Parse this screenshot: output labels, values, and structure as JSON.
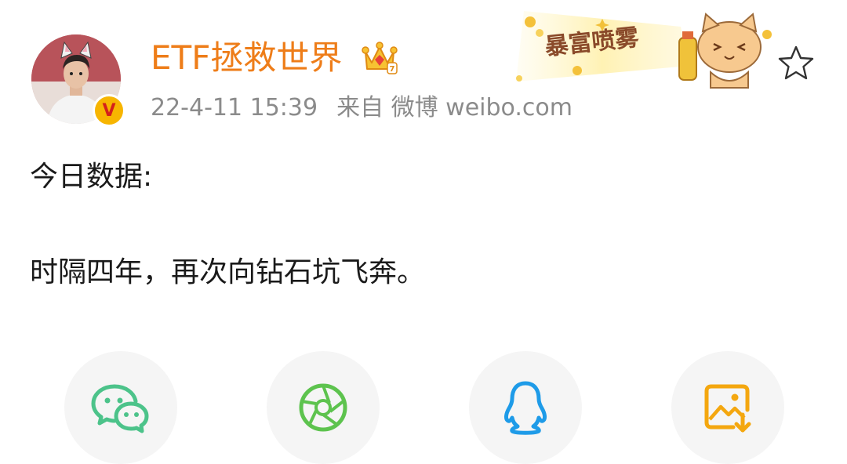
{
  "post": {
    "username": "ETF拯救世界",
    "timestamp": "22-4-11 15:39",
    "source_prefix": "来自",
    "source_name": "微博 weibo.com",
    "content_lines": [
      "今日数据:",
      "时隔四年，再次向钻石坑飞奔。"
    ],
    "verified_badge": "V"
  },
  "decoration": {
    "banner_text": "暴富喷雾"
  },
  "share": {
    "buttons": [
      {
        "icon": "wechat-icon",
        "color": "#4cc38a"
      },
      {
        "icon": "moments-icon",
        "color": "#5dc34e"
      },
      {
        "icon": "qq-icon",
        "color": "#1e9be8"
      },
      {
        "icon": "save-image-icon",
        "color": "#f4a70f"
      }
    ]
  },
  "colors": {
    "username": "#ee7d19",
    "meta_text": "#8b8b8b",
    "body_text": "#1a1a1a"
  }
}
